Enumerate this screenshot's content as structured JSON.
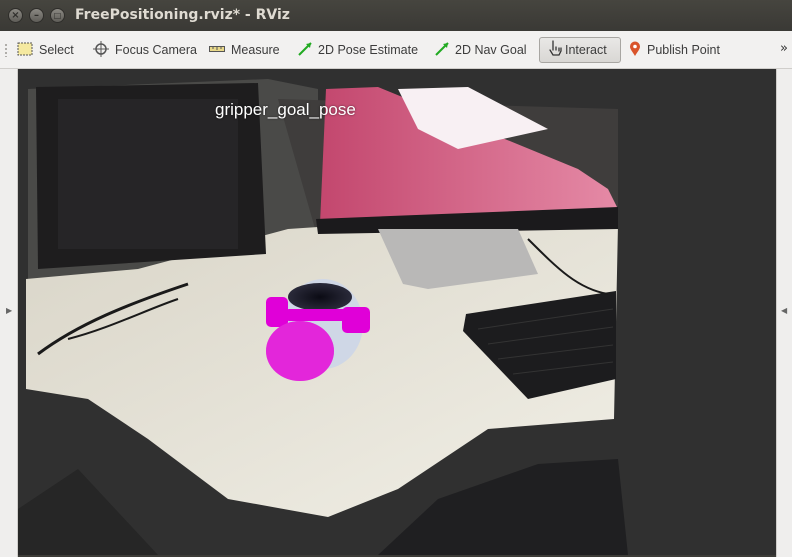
{
  "window": {
    "title": "FreePositioning.rviz* - RViz",
    "buttons": {
      "close": "×",
      "minimize": "–",
      "maximize": "□"
    }
  },
  "toolbar": {
    "tools": [
      {
        "label": "Select",
        "icon": "select-icon"
      },
      {
        "label": "Focus Camera",
        "icon": "focus-camera-icon"
      },
      {
        "label": "Measure",
        "icon": "measure-icon"
      },
      {
        "label": "2D Pose Estimate",
        "icon": "pose-estimate-icon"
      },
      {
        "label": "2D Nav Goal",
        "icon": "nav-goal-icon"
      },
      {
        "label": "Interact",
        "icon": "hand-pointer-icon",
        "active": true
      },
      {
        "label": "Publish Point",
        "icon": "map-pin-icon"
      }
    ],
    "more": "»"
  },
  "viewport": {
    "label": "gripper_goal_pose"
  },
  "colors": {
    "title_bar": "#3c3b37",
    "toolbar": "#f2f1f0",
    "marker": "#e000d8",
    "viewport_bg": "#303030"
  }
}
